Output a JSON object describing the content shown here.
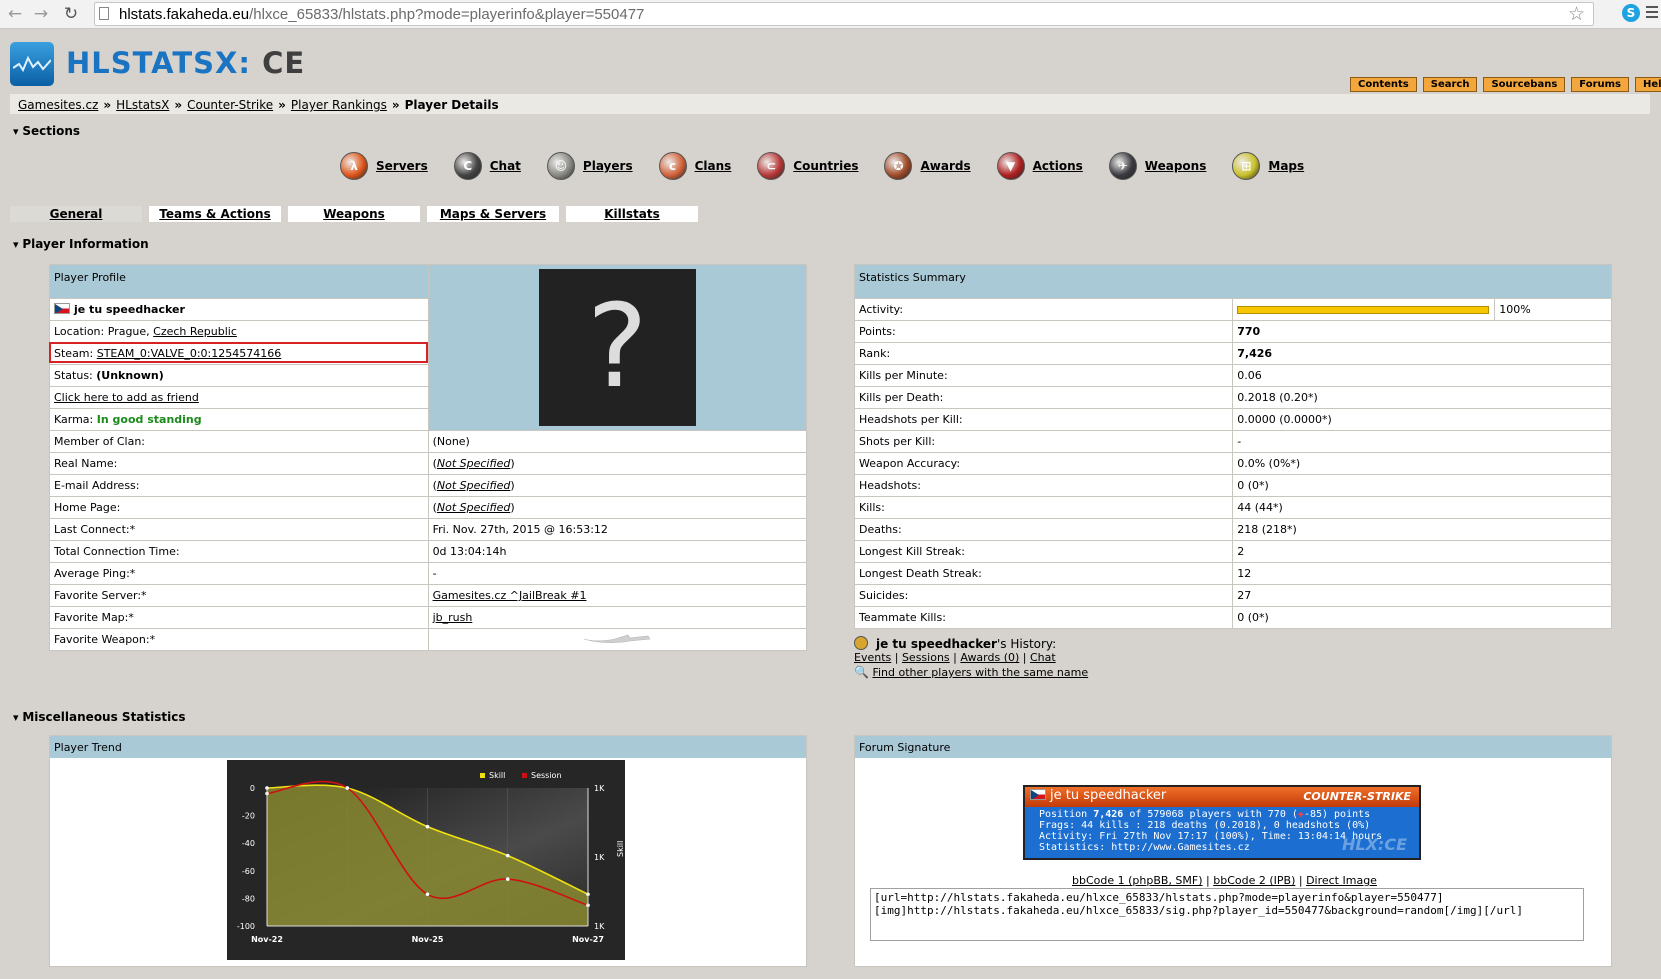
{
  "browser": {
    "url_domain": "hlstats.fakaheda.eu",
    "url_path": "/hlxce_65833/hlstats.php?mode=playerinfo&player=550477"
  },
  "header": {
    "logo_main": "HLSTATSX",
    "logo_sep": ":",
    "logo_ce": "CE",
    "top_links": [
      "Contents",
      "Search",
      "Sourcebans",
      "Forums",
      "Help"
    ]
  },
  "breadcrumb": {
    "items": [
      "Gamesites.cz",
      "HLstatsX",
      "Counter-Strike",
      "Player Rankings"
    ],
    "current": "Player Details",
    "sep": "»"
  },
  "sections": {
    "title": "Sections",
    "items": [
      {
        "label": "Servers",
        "icon": "servers-icon",
        "color": "#e0561a",
        "glyph": "λ"
      },
      {
        "label": "Chat",
        "icon": "chat-icon",
        "color": "#444444",
        "glyph": "C"
      },
      {
        "label": "Players",
        "icon": "players-icon",
        "color": "#8a8a84",
        "glyph": "☺"
      },
      {
        "label": "Clans",
        "icon": "clans-icon",
        "color": "#d2623a",
        "glyph": "c"
      },
      {
        "label": "Countries",
        "icon": "countries-icon",
        "color": "#b83838",
        "glyph": "⊂"
      },
      {
        "label": "Awards",
        "icon": "awards-icon",
        "color": "#a04a28",
        "glyph": "✪"
      },
      {
        "label": "Actions",
        "icon": "actions-icon",
        "color": "#b02020",
        "glyph": "▼"
      },
      {
        "label": "Weapons",
        "icon": "weapons-icon",
        "color": "#3a3a40",
        "glyph": "✈"
      },
      {
        "label": "Maps",
        "icon": "maps-icon",
        "color": "#c9c22a",
        "glyph": "⊞"
      }
    ]
  },
  "tabs": [
    "General",
    "Teams & Actions",
    "Weapons",
    "Maps & Servers",
    "Killstats"
  ],
  "player_info": {
    "title": "Player Information",
    "profile_header": "Player Profile",
    "name": "je tu speedhacker",
    "location_label": "Location:",
    "location_city": "Prague,",
    "location_country": "Czech Republic",
    "steam_label": "Steam:",
    "steam_id": "STEAM_0:VALVE_0:0:1254574166",
    "status_label": "Status:",
    "status_value": "(Unknown)",
    "friend_link": "Click here to add as friend",
    "karma_label": "Karma:",
    "karma_value": "In good standing",
    "photo_glyph": "?",
    "rows": [
      {
        "label": "Member of Clan:",
        "value": "(None)",
        "type": "text"
      },
      {
        "label": "Real Name:",
        "value": "Not Specified",
        "type": "ns"
      },
      {
        "label": "E-mail Address:",
        "value": "Not Specified",
        "type": "ns"
      },
      {
        "label": "Home Page:",
        "value": "Not Specified",
        "type": "ns"
      },
      {
        "label": "Last Connect:*",
        "value": "Fri. Nov. 27th, 2015 @ 16:53:12",
        "type": "text"
      },
      {
        "label": "Total Connection Time:",
        "value": "0d 13:04:14h",
        "type": "text"
      },
      {
        "label": "Average Ping:*",
        "value": "-",
        "type": "text"
      },
      {
        "label": "Favorite Server:*",
        "value": "Gamesites.cz ^JailBreak #1",
        "type": "link"
      },
      {
        "label": "Favorite Map:*",
        "value": "jb_rush",
        "type": "link"
      }
    ],
    "fav_weapon_label": "Favorite Weapon:*"
  },
  "stats_summary": {
    "header": "Statistics Summary",
    "activity_label": "Activity:",
    "activity_value": "100%",
    "activity_fraction": 1.0,
    "rows": [
      {
        "label": "Points:",
        "value": "770",
        "bold": true
      },
      {
        "label": "Rank:",
        "value": "7,426",
        "bold": true
      },
      {
        "label": "Kills per Minute:",
        "value": "0.06"
      },
      {
        "label": "Kills per Death:",
        "value": "0.2018 (0.20*)"
      },
      {
        "label": "Headshots per Kill:",
        "value": "0.0000 (0.0000*)"
      },
      {
        "label": "Shots per Kill:",
        "value": "-"
      },
      {
        "label": "Weapon Accuracy:",
        "value": "0.0% (0%*)"
      },
      {
        "label": "Headshots:",
        "value": "0 (0*)"
      },
      {
        "label": "Kills:",
        "value": "44 (44*)"
      },
      {
        "label": "Deaths:",
        "value": "218 (218*)"
      },
      {
        "label": "Longest Kill Streak:",
        "value": "2"
      },
      {
        "label": "Longest Death Streak:",
        "value": "12"
      },
      {
        "label": "Suicides:",
        "value": "27"
      },
      {
        "label": "Teammate Kills:",
        "value": "0 (0*)"
      }
    ]
  },
  "history": {
    "name": "je tu speedhacker",
    "suffix": "'s History:",
    "links": [
      "Events",
      "Sessions",
      "Awards (0)",
      "Chat"
    ],
    "find_link": "Find other players with the same name"
  },
  "misc": {
    "title": "Miscellaneous Statistics",
    "trend_header": "Player Trend",
    "signature_header": "Forum Signature"
  },
  "chart_data": {
    "type": "line",
    "x": [
      "Nov-22",
      "Nov-23",
      "Nov-25",
      "Nov-26",
      "Nov-27"
    ],
    "x_tick_labels": [
      "Nov-22",
      "Nov-25",
      "Nov-27"
    ],
    "legend": [
      "Skill",
      "Session"
    ],
    "left_ticks": [
      "0",
      "-20",
      "-40",
      "-60",
      "-80",
      "-100"
    ],
    "right_ticks": [
      "1K",
      "1K",
      "1K"
    ],
    "right_axis_label": "Skill",
    "series": [
      {
        "name": "Skill",
        "color": "#f0e010",
        "values": [
          0,
          0,
          -28,
          -49,
          -77
        ]
      },
      {
        "name": "Session",
        "color": "#d01010",
        "values": [
          -4,
          0,
          -77,
          -66,
          -85
        ]
      }
    ],
    "ylim": [
      -100,
      0
    ]
  },
  "signature": {
    "name": "je tu speedhacker",
    "brand": "COUNTER-STRIKE",
    "line1_pre": "Position ",
    "line1_rank": "7,426",
    "line1_post": " of 579068 players with 770 (",
    "line1_delta": "-85",
    "line1_end": ") points",
    "line2": "Frags: 44 kills : 218 deaths (0.2018), 0 headshots (0%)",
    "line3": "Activity: Fri 27th Nov 17:17 (100%), Time: 13:04:14 hours",
    "line4": "Statistics: http://www.Gamesites.cz",
    "watermark": "HLX:CE",
    "bbcode_links": [
      "bbCode 1 (phpBB, SMF)",
      "bbCode 2 (IPB)",
      "Direct Image"
    ],
    "code": "[url=http://hlstats.fakaheda.eu/hlxce_65833/hlstats.php?mode=playerinfo&player=550477]\n[img]http://hlstats.fakaheda.eu/hlxce_65833/sig.php?player_id=550477&background=random[/img][/url]"
  }
}
